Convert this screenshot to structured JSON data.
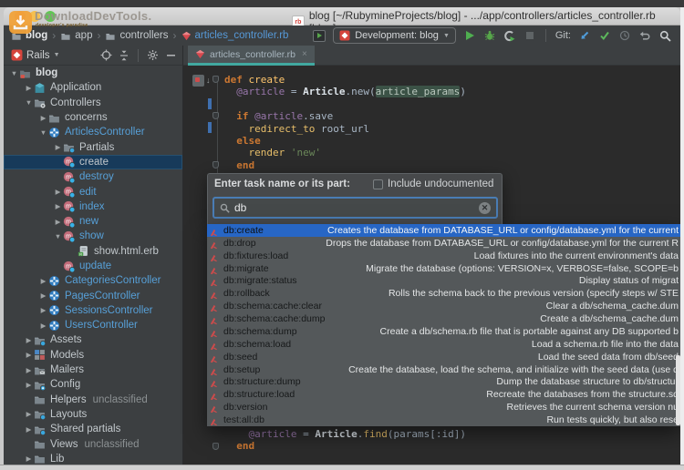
{
  "window": {
    "title": "blog [~/RubymineProjects/blog] - .../app/controllers/articles_controller.rb [blog]",
    "doc_icon_text": "rb",
    "watermark": {
      "name": "DownloadDevTools.",
      "tagline": "developer's paradise"
    }
  },
  "navbar": {
    "breadcrumbs": [
      {
        "label": "blog",
        "icon": "folder"
      },
      {
        "label": "app",
        "icon": "folder"
      },
      {
        "label": "controllers",
        "icon": "folder"
      },
      {
        "label": "articles_controller.rb",
        "icon": "ruby-file"
      }
    ],
    "run_config": "Development: blog",
    "git_label": "Git:"
  },
  "project_panel": {
    "view_selector": "Rails"
  },
  "editor": {
    "tab": "articles_controller.rb",
    "tab_close": "×",
    "code_top": [
      {
        "segments": [
          {
            "t": "def ",
            "c": "kw"
          },
          {
            "t": "create",
            "c": "meth"
          }
        ]
      },
      {
        "segments": [
          {
            "t": "  ",
            "c": "plain"
          },
          {
            "t": "@article",
            "c": "ivar"
          },
          {
            "t": " = ",
            "c": "plain"
          },
          {
            "t": "Article",
            "c": "const"
          },
          {
            "t": ".new(",
            "c": "plain"
          },
          {
            "t": "article_params",
            "c": "hl"
          },
          {
            "t": ")",
            "c": "plain"
          }
        ]
      },
      {
        "segments": []
      },
      {
        "segments": [
          {
            "t": "  ",
            "c": "plain"
          },
          {
            "t": "if ",
            "c": "kw"
          },
          {
            "t": "@article",
            "c": "ivar"
          },
          {
            "t": ".save",
            "c": "plain"
          }
        ]
      },
      {
        "segments": [
          {
            "t": "    ",
            "c": "plain"
          },
          {
            "t": "redirect_to ",
            "c": "rails"
          },
          {
            "t": "root_url",
            "c": "plain"
          }
        ]
      },
      {
        "segments": [
          {
            "t": "  ",
            "c": "plain"
          },
          {
            "t": "else",
            "c": "kw"
          }
        ]
      },
      {
        "segments": [
          {
            "t": "    ",
            "c": "plain"
          },
          {
            "t": "render ",
            "c": "rails"
          },
          {
            "t": "'new'",
            "c": "str"
          }
        ]
      },
      {
        "segments": [
          {
            "t": "  ",
            "c": "plain"
          },
          {
            "t": "end",
            "c": "kw"
          }
        ]
      }
    ],
    "code_bottom": [
      {
        "segments": [
          {
            "t": "    ",
            "c": "plain"
          },
          {
            "t": "@article",
            "c": "ivar"
          },
          {
            "t": " = ",
            "c": "plain"
          },
          {
            "t": "Article",
            "c": "const"
          },
          {
            "t": ".",
            "c": "plain"
          },
          {
            "t": "find",
            "c": "rails"
          },
          {
            "t": "(params[:id])",
            "c": "plain"
          }
        ]
      },
      {
        "segments": [
          {
            "t": "  ",
            "c": "plain"
          },
          {
            "t": "end",
            "c": "kw"
          }
        ]
      }
    ]
  },
  "tree": {
    "items": [
      {
        "label": "blog",
        "level": 0,
        "arrow": "open",
        "icon": "project-folder",
        "bold": true
      },
      {
        "label": "Application",
        "level": 1,
        "arrow": "closed",
        "icon": "cube"
      },
      {
        "label": "Controllers",
        "level": 1,
        "arrow": "open",
        "icon": "folder-gear"
      },
      {
        "label": "concerns",
        "level": 2,
        "arrow": "closed",
        "icon": "folder"
      },
      {
        "label": "ArticlesController",
        "level": 2,
        "arrow": "open",
        "icon": "controller",
        "blue": true
      },
      {
        "label": "Partials",
        "level": 3,
        "arrow": "closed",
        "icon": "folder-dot"
      },
      {
        "label": "create",
        "level": 3,
        "arrow": "none",
        "icon": "method",
        "selected": true
      },
      {
        "label": "destroy",
        "level": 3,
        "arrow": "none",
        "icon": "method",
        "blue": true
      },
      {
        "label": "edit",
        "level": 3,
        "arrow": "closed",
        "icon": "method",
        "blue": true
      },
      {
        "label": "index",
        "level": 3,
        "arrow": "closed",
        "icon": "method",
        "blue": true
      },
      {
        "label": "new",
        "level": 3,
        "arrow": "closed",
        "icon": "method",
        "blue": true
      },
      {
        "label": "show",
        "level": 3,
        "arrow": "open",
        "icon": "method",
        "blue": true
      },
      {
        "label": "show.html.erb",
        "level": 4,
        "arrow": "none",
        "icon": "erb"
      },
      {
        "label": "update",
        "level": 3,
        "arrow": "none",
        "icon": "method",
        "blue": true
      },
      {
        "label": "CategoriesController",
        "level": 2,
        "arrow": "closed",
        "icon": "controller",
        "blue": true
      },
      {
        "label": "PagesController",
        "level": 2,
        "arrow": "closed",
        "icon": "controller",
        "blue": true
      },
      {
        "label": "SessionsController",
        "level": 2,
        "arrow": "closed",
        "icon": "controller",
        "blue": true
      },
      {
        "label": "UsersController",
        "level": 2,
        "arrow": "closed",
        "icon": "controller",
        "blue": true
      },
      {
        "label": "Assets",
        "level": 1,
        "arrow": "closed",
        "icon": "folder-dot"
      },
      {
        "label": "Models",
        "level": 1,
        "arrow": "closed",
        "icon": "models"
      },
      {
        "label": "Mailers",
        "level": 1,
        "arrow": "closed",
        "icon": "folder-mail"
      },
      {
        "label": "Config",
        "level": 1,
        "arrow": "closed",
        "icon": "folder-config"
      },
      {
        "label": "Helpers",
        "level": 1,
        "arrow": "none",
        "icon": "folder",
        "extra": "unclassified"
      },
      {
        "label": "Layouts",
        "level": 1,
        "arrow": "closed",
        "icon": "folder-dot"
      },
      {
        "label": "Shared partials",
        "level": 1,
        "arrow": "closed",
        "icon": "folder-dot"
      },
      {
        "label": "Views",
        "level": 1,
        "arrow": "none",
        "icon": "folder",
        "extra": "unclassified"
      },
      {
        "label": "Lib",
        "level": 1,
        "arrow": "closed",
        "icon": "folder"
      }
    ]
  },
  "task_popup": {
    "prompt": "Enter task name or its part:",
    "checkbox_label": "Include undocumented",
    "search_value": "db",
    "tasks": [
      {
        "name": "db:create",
        "desc": "Creates the database from DATABASE_URL or config/database.yml for the current",
        "selected": true
      },
      {
        "name": "db:drop",
        "desc": "Drops the database from DATABASE_URL or config/database.yml for the current R"
      },
      {
        "name": "db:fixtures:load",
        "desc": "Load fixtures into the current environment's data"
      },
      {
        "name": "db:migrate",
        "desc": "Migrate the database (options: VERSION=x, VERBOSE=false, SCOPE=b"
      },
      {
        "name": "db:migrate:status",
        "desc": "Display status of migrat"
      },
      {
        "name": "db:rollback",
        "desc": "Rolls the schema back to the previous version (specify steps w/ STE"
      },
      {
        "name": "db:schema:cache:clear",
        "desc": "Clear a db/schema_cache.dum"
      },
      {
        "name": "db:schema:cache:dump",
        "desc": "Create a db/schema_cache.dum"
      },
      {
        "name": "db:schema:dump",
        "desc": "Create a db/schema.rb file that is portable against any DB supported b"
      },
      {
        "name": "db:schema:load",
        "desc": "Load a schema.rb file into the data"
      },
      {
        "name": "db:seed",
        "desc": "Load the seed data from db/seed"
      },
      {
        "name": "db:setup",
        "desc": "Create the database, load the schema, and initialize with the seed data (use d"
      },
      {
        "name": "db:structure:dump",
        "desc": "Dump the database structure to db/structur"
      },
      {
        "name": "db:structure:load",
        "desc": "Recreate the databases from the structure.sq"
      },
      {
        "name": "db:version",
        "desc": "Retrieves the current schema version nu"
      },
      {
        "name": "test:all:db",
        "desc": "Run tests quickly, but also rese"
      }
    ]
  },
  "colors": {
    "selection_blue": "#2766c5",
    "tree_selection": "#173a5a",
    "tab_underline": "#41a8a0",
    "link_blue": "#57a0d8",
    "editor_bg": "#2b2b2b",
    "panel_bg": "#3c3f41"
  }
}
